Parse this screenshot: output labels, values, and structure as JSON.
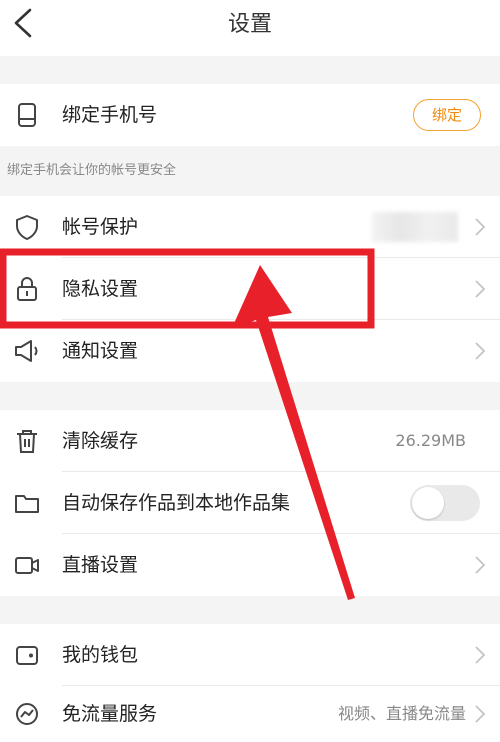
{
  "header": {
    "title": "设置",
    "back_icon": "chevron-left-icon"
  },
  "phone_row": {
    "label": "绑定手机号",
    "button": "绑定",
    "icon": "phone-icon"
  },
  "hint": "绑定手机会让你的帐号更安全",
  "group1": [
    {
      "id": "account-protection",
      "label": "帐号保护",
      "icon": "shield-icon"
    },
    {
      "id": "privacy-settings",
      "label": "隐私设置",
      "icon": "lock-icon"
    },
    {
      "id": "notification-settings",
      "label": "通知设置",
      "icon": "speaker-icon"
    }
  ],
  "group2": {
    "clear_cache": {
      "label": "清除缓存",
      "value": "26.29MB",
      "icon": "trash-icon"
    },
    "auto_save": {
      "label": "自动保存作品到本地作品集",
      "enabled": false,
      "icon": "folder-icon"
    },
    "live_settings": {
      "label": "直播设置",
      "icon": "video-camera-icon"
    }
  },
  "group3": [
    {
      "id": "wallet",
      "label": "我的钱包",
      "icon": "wallet-icon"
    },
    {
      "id": "free-data",
      "label": "免流量服务",
      "value": "视频、直播免流量",
      "icon": "gauge-icon"
    }
  ],
  "colors": {
    "accent": "#f08a10",
    "highlight": "#e8202a"
  }
}
